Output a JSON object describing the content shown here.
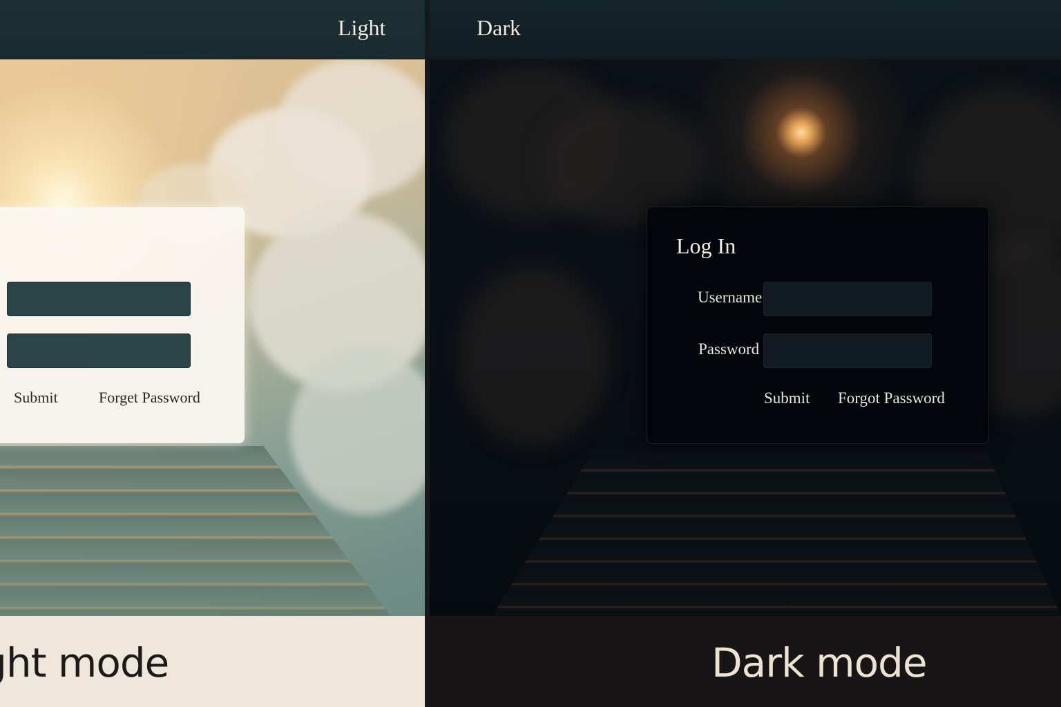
{
  "light": {
    "tab_label": "Light",
    "login": {
      "submit_label": "Submit",
      "forget_label": "Forget Password"
    },
    "caption": "ight mode"
  },
  "dark": {
    "tab_label": "Dark",
    "login": {
      "title": "Log In",
      "username_label": "Username",
      "password_label": "Password",
      "submit_label": "Submit",
      "forgot_label": "Forgot Password"
    },
    "caption": "Dark mode"
  },
  "colors": {
    "light_topbar": "#1c3034",
    "light_input": "#2b4447",
    "dark_topbar": "#14252b",
    "dark_card": "#02060b",
    "dark_input": "#131b22"
  }
}
